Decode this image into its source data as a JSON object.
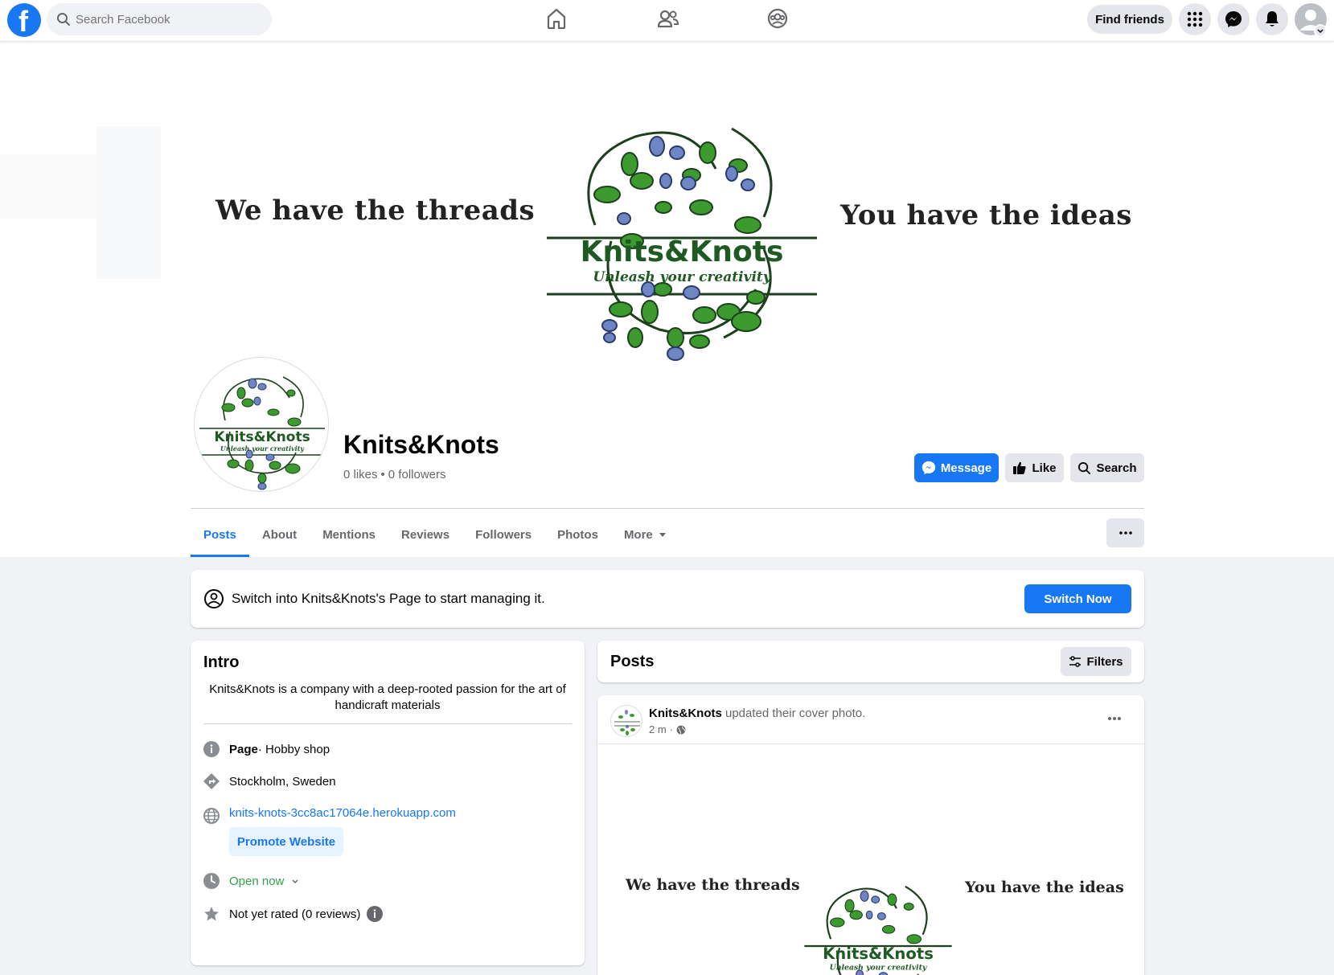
{
  "topbar": {
    "search_placeholder": "Search Facebook",
    "find_friends": "Find friends"
  },
  "cover": {
    "left_text": "We have the threads",
    "right_text": "You have the ideas",
    "logo_name": "Knits&Knots",
    "logo_tagline": "Unleash your creativity"
  },
  "page": {
    "name": "Knits&Knots",
    "likes": "0 likes",
    "separator": "•",
    "followers": "0 followers"
  },
  "actions": {
    "message": "Message",
    "like": "Like",
    "search": "Search"
  },
  "tabs": {
    "posts": "Posts",
    "about": "About",
    "mentions": "Mentions",
    "reviews": "Reviews",
    "followers": "Followers",
    "photos": "Photos",
    "more": "More"
  },
  "switch_banner": {
    "text": "Switch into Knits&Knots's Page to start managing it.",
    "button": "Switch Now"
  },
  "intro": {
    "title": "Intro",
    "bio": "Knits&Knots is a company with a deep-rooted passion for the art of handicraft materials",
    "page_label": "Page",
    "category": " · Hobby shop",
    "location": "Stockholm, Sweden",
    "website": "knits-knots-3cc8ac17064e.herokuapp.com",
    "promote": "Promote Website",
    "hours": "Open now",
    "rating": "Not yet rated (0 reviews)"
  },
  "posts": {
    "title": "Posts",
    "filters": "Filters"
  },
  "post": {
    "author": "Knits&Knots",
    "action": " updated their cover photo.",
    "time": "2 m",
    "dot": "·"
  },
  "colors": {
    "brand": "#1877f2",
    "open": "#31a24c",
    "leaf_green": "#3c9a2e",
    "leaf_blue": "#6f86c4"
  }
}
